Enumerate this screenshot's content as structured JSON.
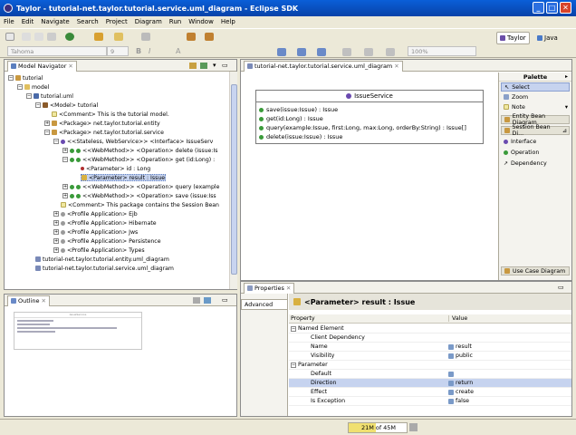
{
  "window": {
    "title": "Taylor - tutorial-net.taylor.tutorial.service.uml_diagram - Eclipse SDK",
    "min": "_",
    "max": "□",
    "close": "✕"
  },
  "menu": [
    "File",
    "Edit",
    "Navigate",
    "Search",
    "Project",
    "Diagram",
    "Run",
    "Window",
    "Help"
  ],
  "toolbar": {
    "font": "Tahoma",
    "size": "9",
    "zoom": "100%"
  },
  "perspectives": {
    "taylor": "Taylor",
    "java": "Java"
  },
  "model_navigator": {
    "tab": "Model Navigator",
    "items": [
      "tutorial",
      "model",
      "tutorial.uml",
      "<Model> tutorial",
      "<Comment> This is the tutorial model.",
      "<Package> net.taylor.tutorial.entity",
      "<Package> net.taylor.tutorial.service",
      "<<Stateless, WebService>> <Interface> IssueServ",
      "<<WebMethod>> <Operation> delete (issue:Is",
      "<<WebMethod>> <Operation> get (id:Long) :",
      "<Parameter> id : Long",
      "<Parameter> result : Issue",
      "<<WebMethod>> <Operation> query (example",
      "<<WebMethod>> <Operation> save (issue:Iss",
      "<Comment> This package contains the Session Bean",
      "<Profile Application> Ejb",
      "<Profile Application> Hibernate",
      "<Profile Application> Jws",
      "<Profile Application> Persistence",
      "<Profile Application> Types",
      "tutorial-net.taylor.tutorial.entity.uml_diagram",
      "tutorial-net.taylor.tutorial.service.uml_diagram"
    ]
  },
  "outline": {
    "tab": "Outline",
    "mini_title": "IssueService"
  },
  "editor": {
    "tab": "tutorial-net.taylor.tutorial.service.uml_diagram",
    "class_name": "IssueService",
    "operations": [
      "save(issue:Issue) : Issue",
      "get(id:Long) : Issue",
      "query(example:Issue, first:Long, max:Long, orderBy:String) : Issue[]",
      "delete(issue:Issue) : Issue"
    ]
  },
  "palette": {
    "title": "Palette",
    "tools": [
      "Select",
      "Zoom",
      "Note"
    ],
    "drawers": [
      "Entity Bean Diagram",
      "Session Bean Di..."
    ],
    "items": [
      "Interface",
      "Operation",
      "Dependency"
    ],
    "bottom_drawer": "Use Case Diagram"
  },
  "properties": {
    "tab": "Properties",
    "side_tab": "Advanced",
    "title": "<Parameter> result : Issue",
    "col_property": "Property",
    "col_value": "Value",
    "rows": [
      {
        "name": "Named Element",
        "value": "",
        "group": true
      },
      {
        "name": "Client Dependency",
        "value": ""
      },
      {
        "name": "Name",
        "value": "result"
      },
      {
        "name": "Visibility",
        "value": "public"
      },
      {
        "name": "Parameter",
        "value": "",
        "group": true
      },
      {
        "name": "Default",
        "value": ""
      },
      {
        "name": "Direction",
        "value": "return"
      },
      {
        "name": "Effect",
        "value": "create"
      },
      {
        "name": "Is Exception",
        "value": "false"
      }
    ]
  },
  "status": {
    "memory_used": "21M",
    "memory_sep": "of",
    "memory_total": "45M"
  },
  "colors": {
    "titlebar": "#0a5fd8",
    "accent": "#316ac5",
    "selection": "#c6d3ef",
    "chrome": "#ece9d8"
  }
}
